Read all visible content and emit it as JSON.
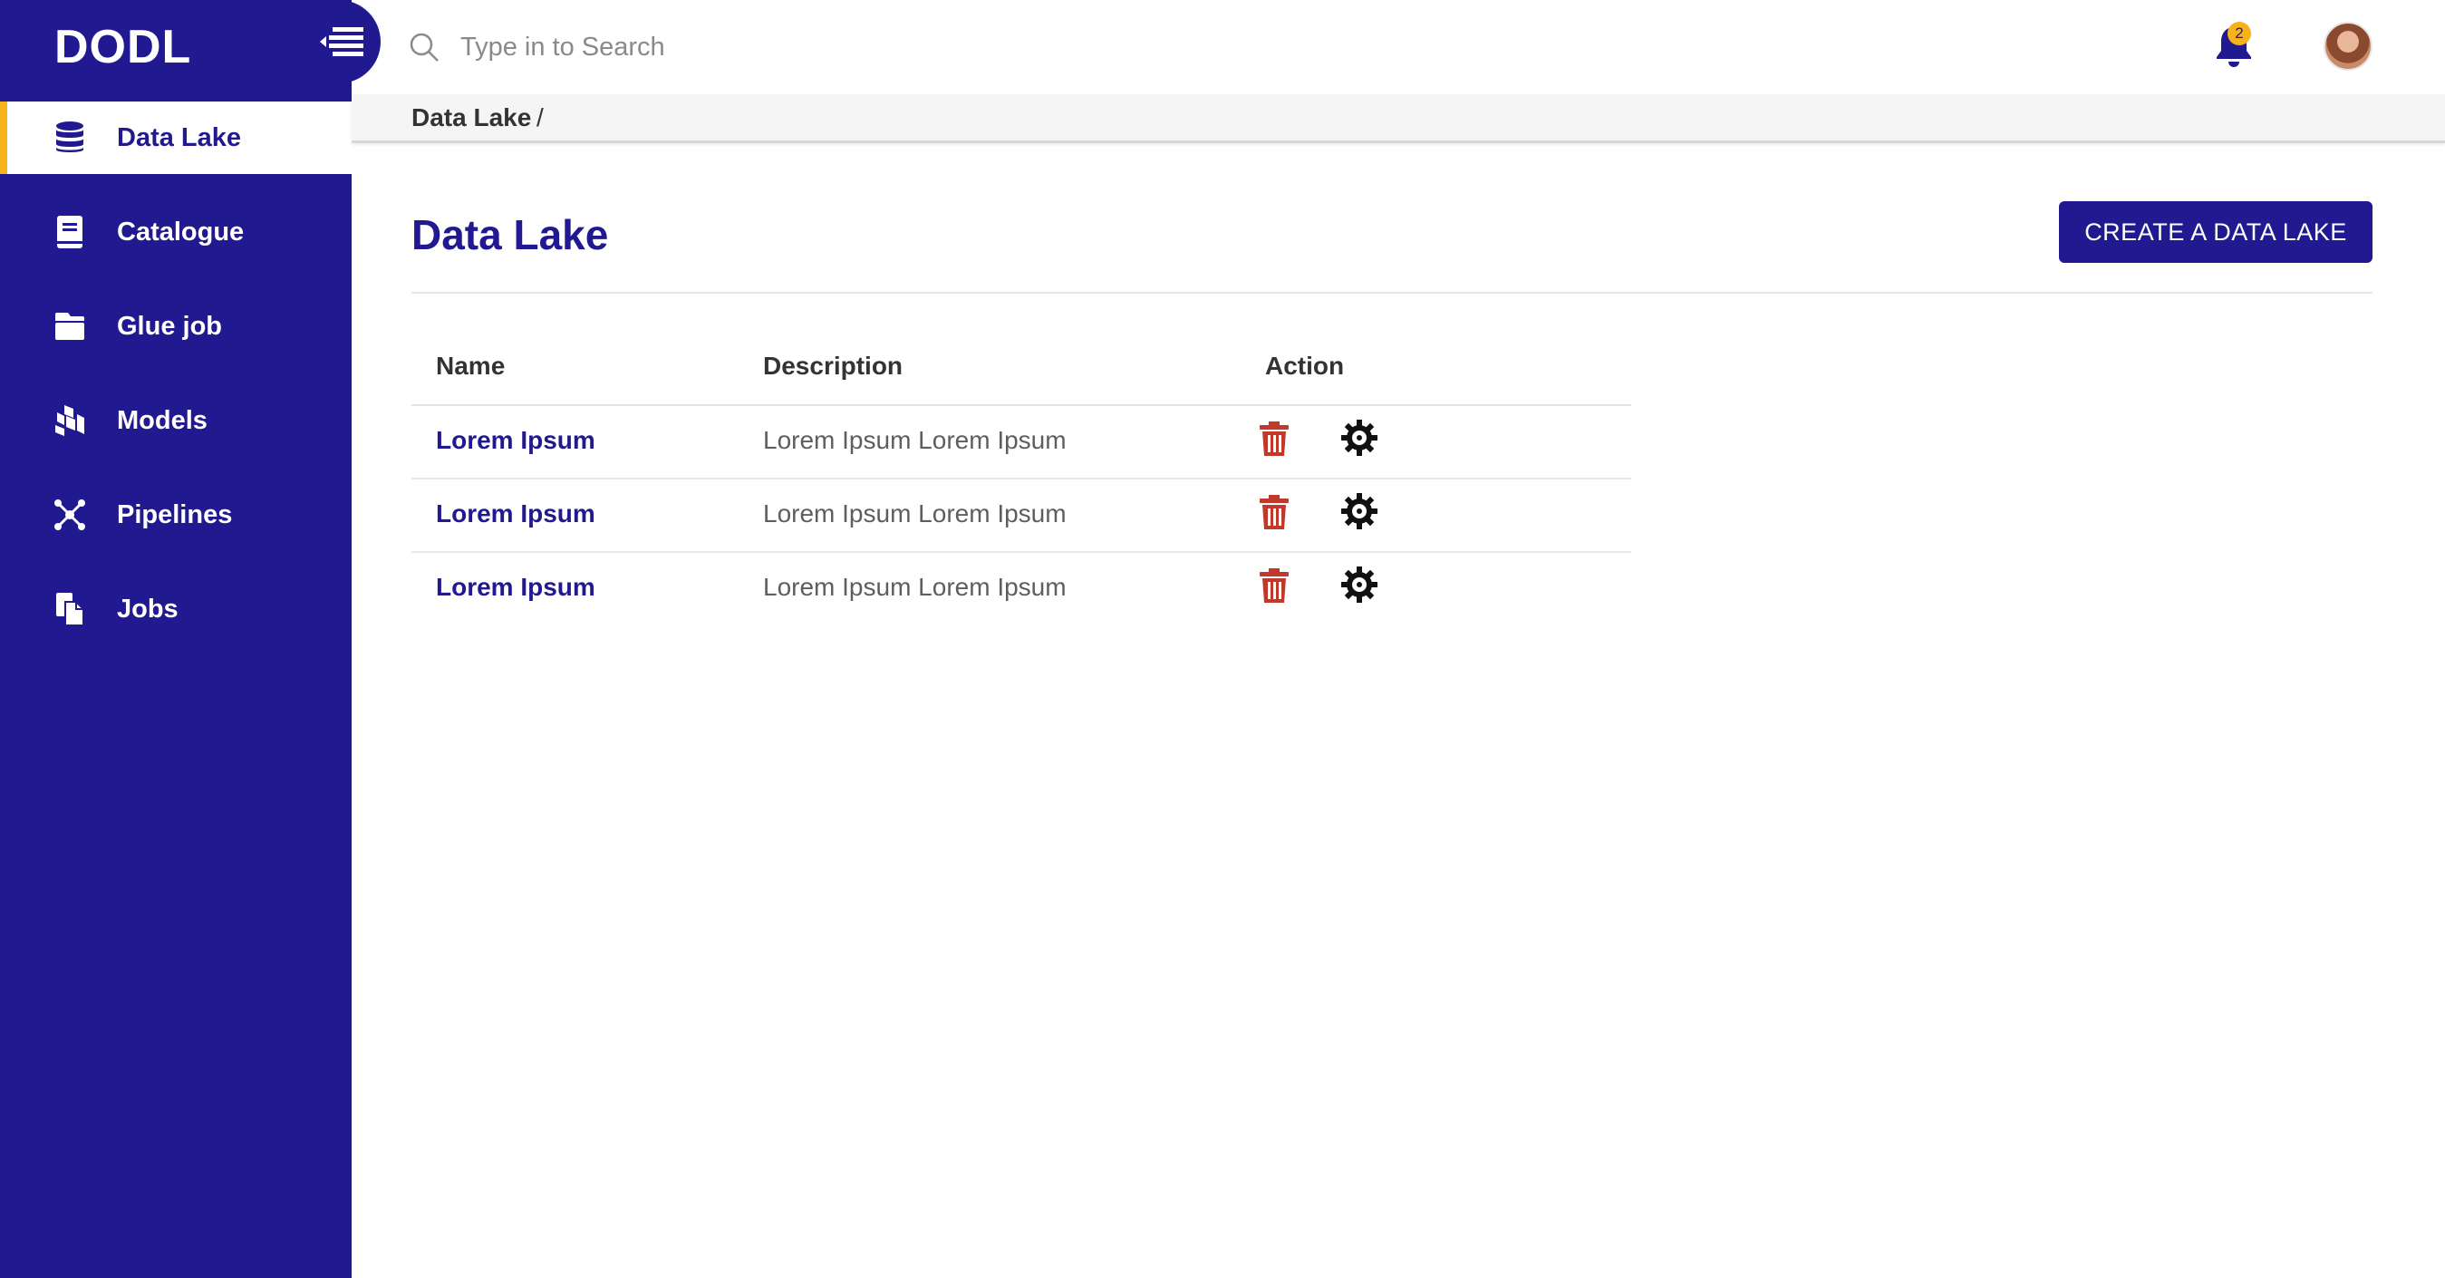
{
  "app": {
    "brand": "DODL"
  },
  "sidebar": {
    "items": [
      {
        "label": "Data Lake",
        "icon": "database-icon",
        "active": true
      },
      {
        "label": "Catalogue",
        "icon": "book-icon",
        "active": false
      },
      {
        "label": "Glue job",
        "icon": "folder-icon",
        "active": false
      },
      {
        "label": "Models",
        "icon": "boxes-icon",
        "active": false
      },
      {
        "label": "Pipelines",
        "icon": "network-icon",
        "active": false
      },
      {
        "label": "Jobs",
        "icon": "files-icon",
        "active": false
      }
    ]
  },
  "topbar": {
    "search_placeholder": "Type in to Search",
    "search_value": "",
    "notifications_count": "2"
  },
  "breadcrumb": {
    "current": "Data Lake",
    "separator": "/"
  },
  "main": {
    "title": "Data Lake",
    "create_button": "CREATE A DATA LAKE",
    "table": {
      "columns": [
        "Name",
        "Description",
        "Action"
      ],
      "rows": [
        {
          "name": "Lorem Ipsum",
          "description": "Lorem Ipsum Lorem Ipsum"
        },
        {
          "name": "Lorem Ipsum",
          "description": "Lorem Ipsum Lorem Ipsum"
        },
        {
          "name": "Lorem Ipsum",
          "description": "Lorem Ipsum Lorem Ipsum"
        }
      ]
    }
  },
  "colors": {
    "primary": "#21198f",
    "accent": "#f6b21b",
    "delete": "#c0392b"
  }
}
